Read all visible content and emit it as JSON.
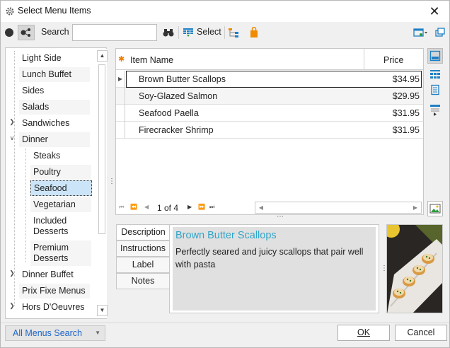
{
  "window": {
    "title": "Select Menu Items",
    "close_glyph": "✕"
  },
  "toolbar": {
    "search_label": "Search",
    "search_value": "",
    "select_label": "Select"
  },
  "tree": {
    "items": [
      {
        "label": "Light Side"
      },
      {
        "label": "Lunch Buffet"
      },
      {
        "label": "Sides"
      },
      {
        "label": "Salads"
      },
      {
        "label": "Sandwiches"
      },
      {
        "label": "Dinner"
      },
      {
        "label": "Steaks"
      },
      {
        "label": "Poultry"
      },
      {
        "label": "Seafood"
      },
      {
        "label": "Vegetarian"
      },
      {
        "label": "Included\nDesserts"
      },
      {
        "label": "Premium\nDesserts"
      },
      {
        "label": "Dinner Buffet"
      },
      {
        "label": "Prix Fixe Menus"
      },
      {
        "label": "Hors D'Oeuvres"
      }
    ],
    "selected": "Seafood"
  },
  "grid": {
    "columns": [
      "Item Name",
      "Price"
    ],
    "rows": [
      {
        "name": "Brown Butter Scallops",
        "price": "$34.95"
      },
      {
        "name": "Soy-Glazed Salmon",
        "price": "$29.95"
      },
      {
        "name": "Seafood Paella",
        "price": "$31.95"
      },
      {
        "name": "Firecracker Shrimp",
        "price": "$31.95"
      }
    ],
    "pager_text": "1 of 4"
  },
  "detail": {
    "tabs": [
      "Description",
      "Instructions",
      "Label",
      "Notes"
    ],
    "active_tab": "Description",
    "title": "Brown Butter Scallops",
    "description": "Perfectly seared and juicy scallops that pair well with pasta"
  },
  "footer": {
    "all_menus_label": "All Menus Search",
    "ok_label": "OK",
    "cancel_label": "Cancel"
  },
  "colors": {
    "accent": "#30a5c8",
    "selection": "#cce4f7",
    "link_blue": "#1e64c8",
    "header_star": "#f07c00"
  }
}
